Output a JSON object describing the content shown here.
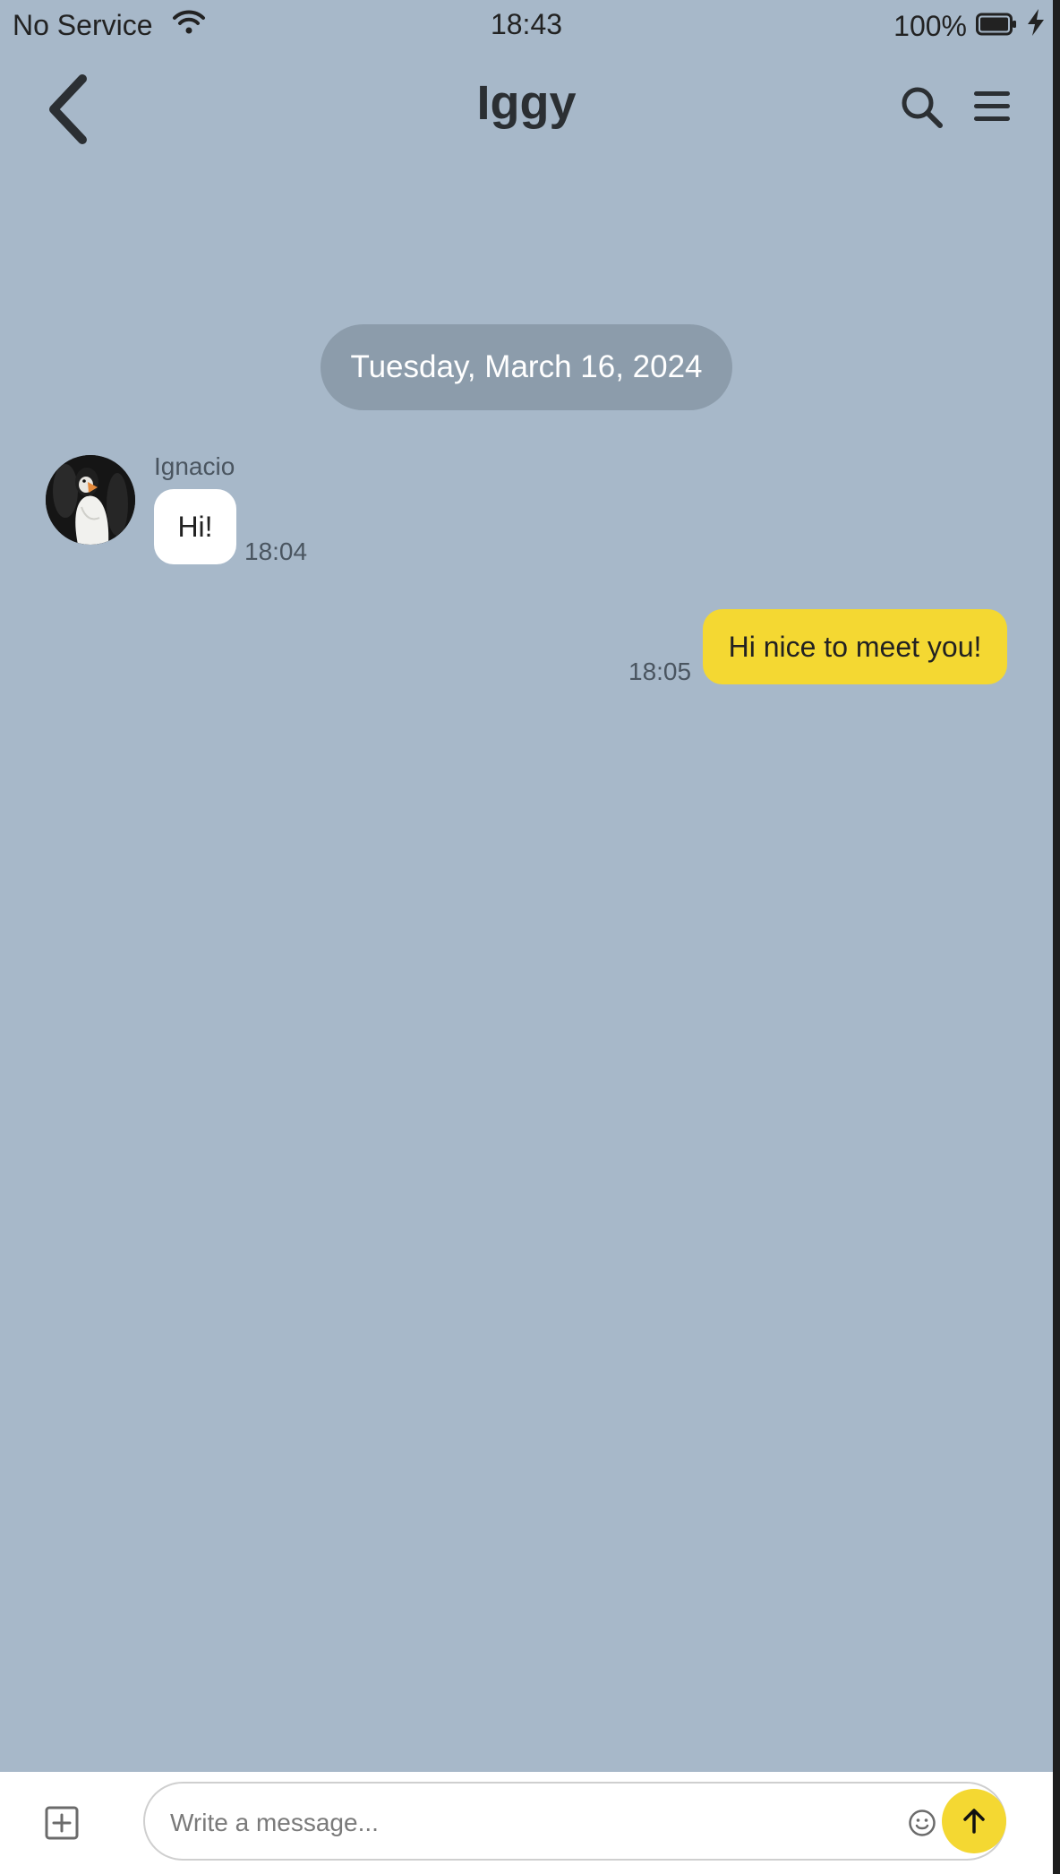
{
  "status_bar": {
    "carrier": "No Service",
    "time": "18:43",
    "battery": "100%",
    "icons": [
      "wifi-icon",
      "battery-icon",
      "charging-bolt-icon"
    ]
  },
  "header": {
    "title": "Iggy",
    "icons": [
      "back-chevron-icon",
      "search-icon",
      "menu-icon"
    ]
  },
  "chat": {
    "date_separator": "Tuesday, March 16, 2024",
    "messages": [
      {
        "direction": "incoming",
        "sender": "Ignacio",
        "text": "Hi!",
        "time": "18:04",
        "avatar": "puffin-avatar"
      },
      {
        "direction": "outgoing",
        "text": "Hi nice to meet you!",
        "time": "18:05"
      }
    ]
  },
  "composer": {
    "placeholder": "Write a message...",
    "value": "",
    "icons": [
      "add-attachment-icon",
      "emoji-icon",
      "send-arrow-icon"
    ]
  },
  "colors": {
    "background": "#a7b8c9",
    "date_pill": "#8c9cab",
    "incoming_bubble": "#ffffff",
    "outgoing_bubble": "#f4d832",
    "send_button": "#f4d832",
    "text_dark": "#2b2f33"
  }
}
